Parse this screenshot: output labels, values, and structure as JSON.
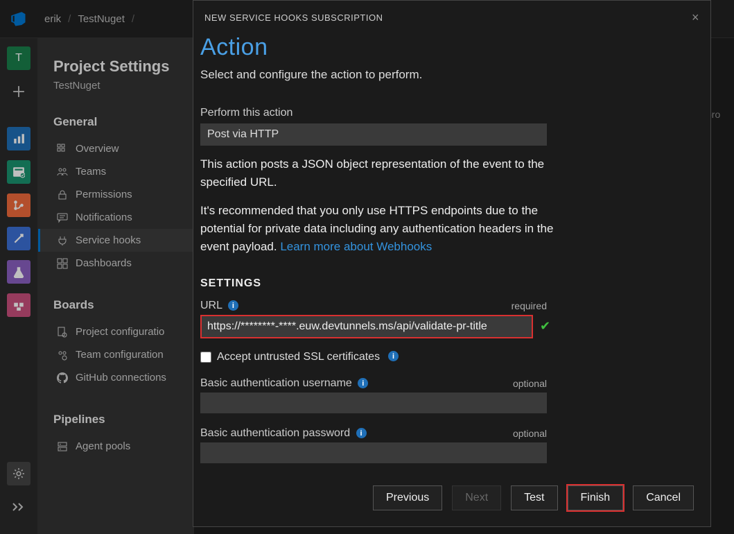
{
  "breadcrumb": {
    "user": "erik",
    "project": "TestNuget",
    "third": ""
  },
  "content_edge_text": "pro",
  "sidebar": {
    "title": "Project Settings",
    "subtitle": "TestNuget",
    "sections": {
      "general": {
        "title": "General",
        "items": [
          {
            "label": "Overview"
          },
          {
            "label": "Teams"
          },
          {
            "label": "Permissions"
          },
          {
            "label": "Notifications"
          },
          {
            "label": "Service hooks"
          },
          {
            "label": "Dashboards"
          }
        ]
      },
      "boards": {
        "title": "Boards",
        "items": [
          {
            "label": "Project configuratio"
          },
          {
            "label": "Team configuration"
          },
          {
            "label": "GitHub connections"
          }
        ]
      },
      "pipelines": {
        "title": "Pipelines",
        "items": [
          {
            "label": "Agent pools"
          }
        ]
      }
    }
  },
  "modal": {
    "header": "NEW SERVICE HOOKS SUBSCRIPTION",
    "title": "Action",
    "subtitle": "Select and configure the action to perform.",
    "perform_label": "Perform this action",
    "perform_value": "Post via HTTP",
    "desc1": "This action posts a JSON object representation of the event to the specified URL.",
    "desc2_prefix": "It's recommended that you only use HTTPS endpoints due to the potential for private data including any authentication headers in the event payload. ",
    "desc2_link": "Learn more about Webhooks",
    "settings_head": "SETTINGS",
    "url_label": "URL",
    "required_tag": "required",
    "url_value": "https://********-****.euw.devtunnels.ms/api/validate-pr-title",
    "ssl_label": "Accept untrusted SSL certificates",
    "user_label": "Basic authentication username",
    "optional_tag": "optional",
    "pass_label": "Basic authentication password",
    "buttons": {
      "previous": "Previous",
      "next": "Next",
      "test": "Test",
      "finish": "Finish",
      "cancel": "Cancel"
    }
  }
}
